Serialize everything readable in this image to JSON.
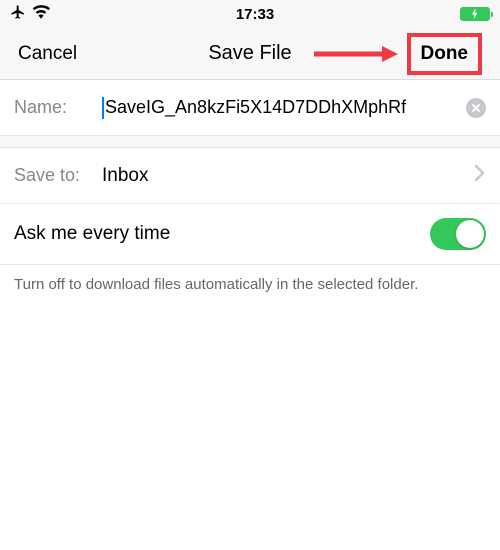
{
  "status": {
    "time": "17:33"
  },
  "nav": {
    "cancel": "Cancel",
    "title": "Save File",
    "done": "Done"
  },
  "nameRow": {
    "label": "Name:",
    "value": "SaveIG_An8kzFi5X14D7DDhXMphRf"
  },
  "saveToRow": {
    "label": "Save to:",
    "value": "Inbox"
  },
  "toggleRow": {
    "label": "Ask me every time",
    "on": true
  },
  "footer": "Turn off to download files automatically in the selected folder."
}
